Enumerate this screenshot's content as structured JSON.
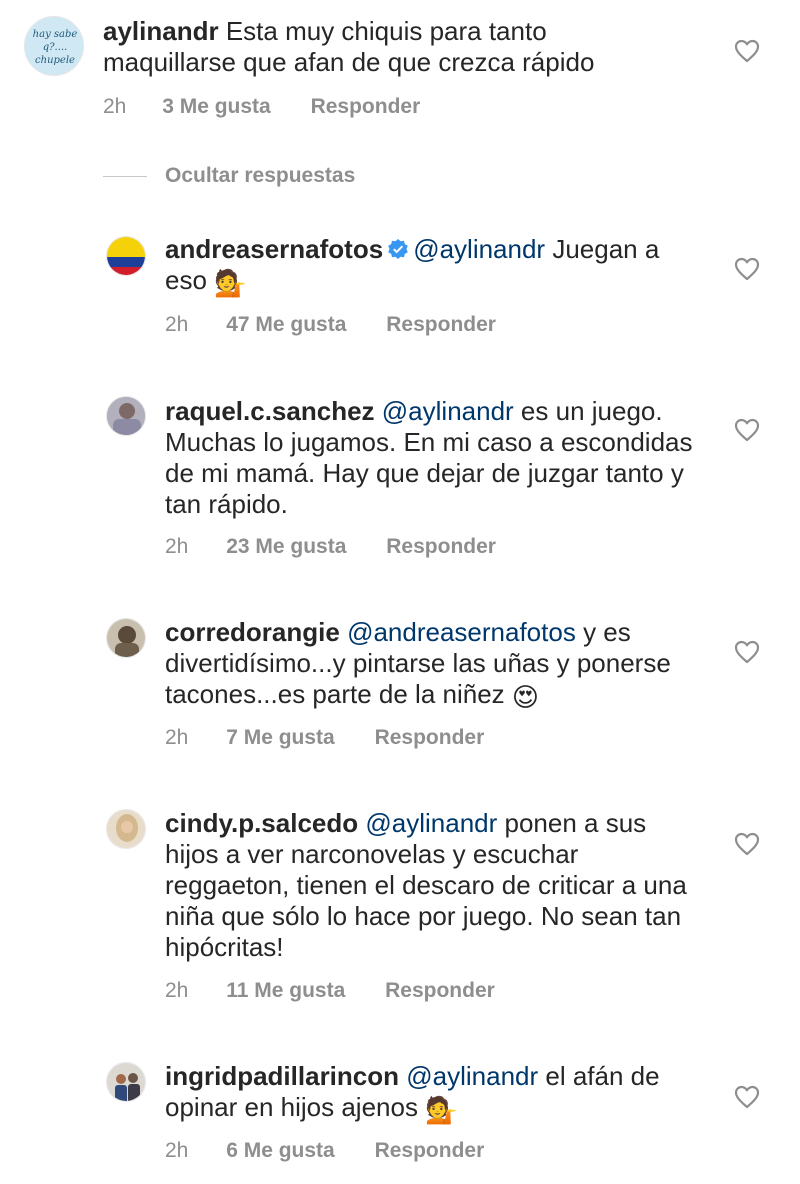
{
  "top_comment": {
    "username": "aylinandr",
    "text": "Esta muy chiquis para tanto maquillarse que afan de que crezca rápido",
    "time": "2h",
    "likes": "3 Me gusta",
    "reply_label": "Responder",
    "avatar_text": "hay sabe q?.... chupele"
  },
  "hide_replies_label": "Ocultar respuestas",
  "replies": [
    {
      "username": "andreasernafotos",
      "verified": true,
      "mention": "@aylinandr",
      "text": "Juegan a eso",
      "time": "2h",
      "likes": "47 Me gusta",
      "reply_label": "Responder"
    },
    {
      "username": "raquel.c.sanchez",
      "mention": "@aylinandr",
      "text": "es un juego. Muchas lo jugamos. En mi caso a escondidas de mi mamá. Hay que dejar de juzgar tanto y tan rápido.",
      "time": "2h",
      "likes": "23 Me gusta",
      "reply_label": "Responder"
    },
    {
      "username": "corredorangie",
      "mention": "@andreasernafotos",
      "text": "y es divertidísimo...y pintarse las uñas y ponerse tacones...es parte de la niñez",
      "time": "2h",
      "likes": "7 Me gusta",
      "reply_label": "Responder"
    },
    {
      "username": "cindy.p.salcedo",
      "mention": "@aylinandr",
      "text": "ponen a sus hijos a ver narconovelas y escuchar reggaeton, tienen el descaro de criticar a una niña que sólo lo hace por juego. No sean tan hipócritas!",
      "time": "2h",
      "likes": "11 Me gusta",
      "reply_label": "Responder"
    },
    {
      "username": "ingridpadillarincon",
      "mention": "@aylinandr",
      "text": "el afán de opinar en hijos ajenos",
      "time": "2h",
      "likes": "6 Me gusta",
      "reply_label": "Responder"
    }
  ],
  "colors": {
    "text": "#262626",
    "mention": "#00376b",
    "meta": "#8e8e8e",
    "verified": "#3897f0"
  },
  "icons": {
    "like": "heart-outline-icon",
    "verified": "verified-badge-icon"
  }
}
